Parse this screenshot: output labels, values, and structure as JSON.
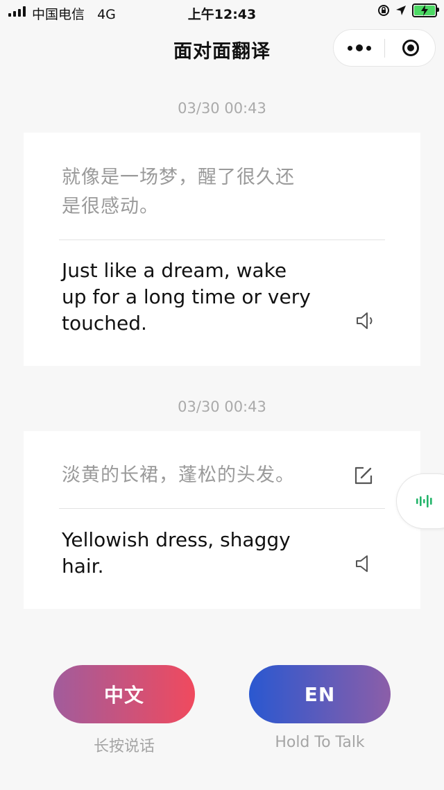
{
  "status_bar": {
    "carrier": "中国电信",
    "network": "4G",
    "time": "上午12:43",
    "colors": {
      "battery": "#4cd964"
    }
  },
  "nav": {
    "title": "面对面翻译"
  },
  "messages": [
    {
      "timestamp": "03/30 00:43",
      "source_lines": [
        "就像是一场梦，醒了很久还",
        "是很感动。"
      ],
      "target_lines": [
        "Just like a dream, wake",
        "up for a long time or very",
        "touched."
      ],
      "target_icon": "speaker-playing-icon"
    },
    {
      "timestamp": "03/30 00:43",
      "source_lines": [
        "淡黄的长裙，蓬松的头发。"
      ],
      "source_icon": "edit-icon",
      "target_lines": [
        "Yellowish dress, shaggy",
        "hair."
      ],
      "target_icon": "speaker-icon"
    }
  ],
  "float_button": {
    "icon": "voice-wave-icon",
    "color": "#23b46a"
  },
  "buttons": {
    "zh": {
      "label": "中文",
      "hint": "长按说话"
    },
    "en": {
      "label": "EN",
      "hint": "Hold To Talk"
    }
  },
  "colors": {
    "zh_gradient": [
      "#a15c9c",
      "#f04a5e"
    ],
    "en_gradient": [
      "#2a58d0",
      "#8c5ea8"
    ]
  }
}
